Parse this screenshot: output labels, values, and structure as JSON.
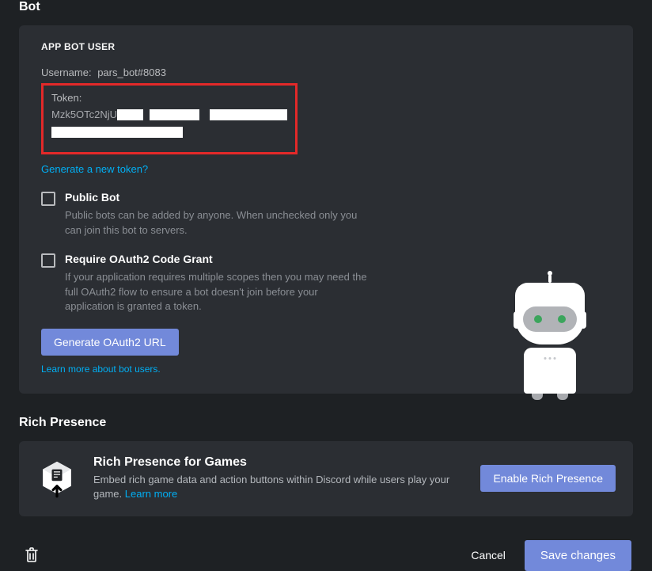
{
  "bot": {
    "section_title": "Bot",
    "card_header": "APP BOT USER",
    "username_label": "Username:",
    "username_value": "pars_bot#8083",
    "token_label": "Token:",
    "token_prefix": "Mzk5OTc2NjU",
    "generate_token_link": "Generate a new token?",
    "public_bot": {
      "title": "Public Bot",
      "desc": "Public bots can be added by anyone. When unchecked only you can join this bot to servers."
    },
    "oauth2_grant": {
      "title": "Require OAuth2 Code Grant",
      "desc": "If your application requires multiple scopes then you may need the full OAuth2 flow to ensure a bot doesn't join before your application is granted a token."
    },
    "generate_oauth_btn": "Generate OAuth2 URL",
    "learn_more_link": "Learn more about bot users."
  },
  "rich_presence": {
    "section_title": "Rich Presence",
    "title": "Rich Presence for Games",
    "desc": "Embed rich game data and action buttons within Discord while users play your game. ",
    "learn_more": "Learn more",
    "enable_btn": "Enable Rich Presence"
  },
  "footer": {
    "cancel": "Cancel",
    "save": "Save changes"
  }
}
